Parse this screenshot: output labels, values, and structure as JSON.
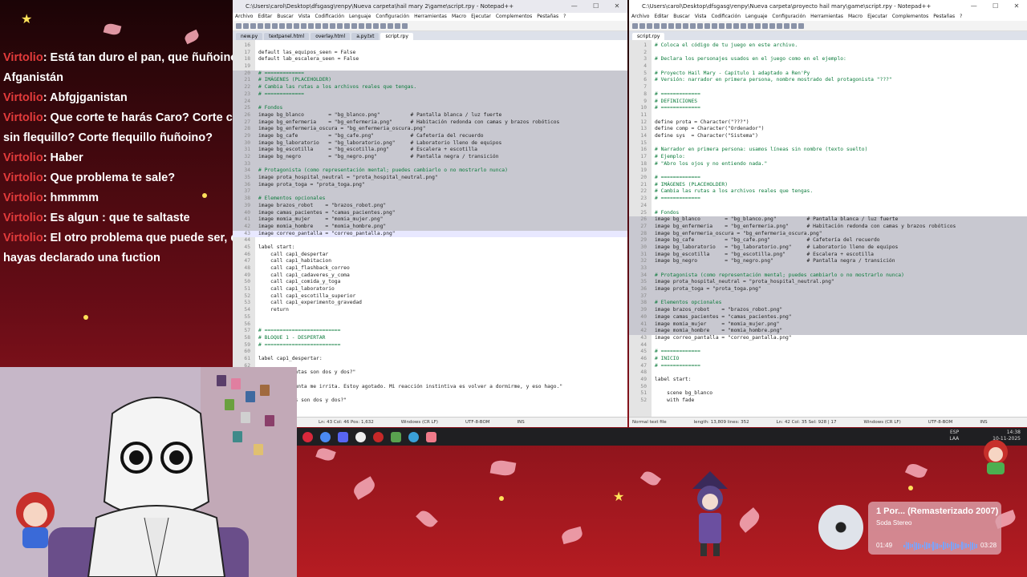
{
  "chat": {
    "lines": [
      {
        "user": "Virtolio",
        "msg": ": Está tan duro el pan, que ñuñoino en Afganistán"
      },
      {
        "user": "Virtolio",
        "msg": ": Abfgjganistan"
      },
      {
        "user": "Virtolio",
        "msg": ": Que corte te harás Caro? Corte callampa, sin flequillo? Corte flequillo ñuñoino?"
      },
      {
        "user": "Virtolio",
        "msg": ": Haber"
      },
      {
        "user": "Virtolio",
        "msg": ": Que problema te sale?"
      },
      {
        "user": "Virtolio",
        "msg": ": hmmmm"
      },
      {
        "user": "Virtolio",
        "msg": ": Es algun : que te saltaste"
      },
      {
        "user": "Virtolio",
        "msg": ": El otro problema que puede ser, es que no hayas declarado una fuction"
      }
    ]
  },
  "left_window": {
    "title": "C:\\Users\\carol\\Desktop\\dfsgasg\\renpy\\Nueva carpeta\\hail mary 2\\game\\script.rpy - Notepad++",
    "menu": [
      "Archivo",
      "Editar",
      "Buscar",
      "Vista",
      "Codificación",
      "Lenguaje",
      "Configuración",
      "Herramientas",
      "Macro",
      "Ejecutar",
      "Complementos",
      "Pestañas",
      "?"
    ],
    "tabs": [
      "new.py",
      "textpanel.html",
      "overlay.html",
      "a.py.txt",
      "script.rpy"
    ],
    "lines": [
      {
        "n": "16",
        "t": ""
      },
      {
        "n": "17",
        "t": "default las_equipos_seen = False"
      },
      {
        "n": "18",
        "t": "default lab_escalera_seen = False"
      },
      {
        "n": "19",
        "t": ""
      },
      {
        "n": "20",
        "t": "# ============="
      },
      {
        "n": "21",
        "t": "# IMÁGENES (PLACEHOLDER)"
      },
      {
        "n": "22",
        "t": "# Cambia las rutas a los archivos reales que tengas."
      },
      {
        "n": "23",
        "t": "# ============="
      },
      {
        "n": "24",
        "t": ""
      },
      {
        "n": "25",
        "t": "# Fondos"
      },
      {
        "n": "26",
        "t": "image bg_blanco        = \"bg_blanco.png\"          # Pantalla blanca / luz fuerte"
      },
      {
        "n": "27",
        "t": "image bg_enfermeria    = \"bg_enfermeria.png\"      # Habitación redonda con camas y brazos robóticos"
      },
      {
        "n": "28",
        "t": "image bg_enfermeria_oscura = \"bg_enfermeria_oscura.png\""
      },
      {
        "n": "29",
        "t": "image bg_cafe          = \"bg_cafe.png\"            # Cafetería del recuerdo"
      },
      {
        "n": "30",
        "t": "image bg_laboratorio   = \"bg_laboratorio.png\"     # Laboratorio lleno de equipos"
      },
      {
        "n": "31",
        "t": "image bg_escotilla     = \"bg_escotilla.png\"       # Escalera + escotilla"
      },
      {
        "n": "32",
        "t": "image bg_negro         = \"bg_negro.png\"           # Pantalla negra / transición"
      },
      {
        "n": "33",
        "t": ""
      },
      {
        "n": "34",
        "t": "# Protagonista (como representación mental; puedes cambiarlo o no mostrarlo nunca)"
      },
      {
        "n": "35",
        "t": "image prota_hospital_neutral = \"prota_hospital_neutral.png\""
      },
      {
        "n": "36",
        "t": "image prota_toga = \"prota_toga.png\""
      },
      {
        "n": "37",
        "t": ""
      },
      {
        "n": "38",
        "t": "# Elementos opcionales"
      },
      {
        "n": "39",
        "t": "image brazos_robot    = \"brazos_robot.png\""
      },
      {
        "n": "40",
        "t": "image camas_pacientes = \"camas_pacientes.png\""
      },
      {
        "n": "41",
        "t": "image momia_mujer     = \"momia_mujer.png\""
      },
      {
        "n": "42",
        "t": "image momia_hombre    = \"momia_hombre.png\""
      },
      {
        "n": "43",
        "t": "image correo_pantalla = \"correo_pantalla.png\""
      },
      {
        "n": "44",
        "t": ""
      },
      {
        "n": "45",
        "t": "label start:"
      },
      {
        "n": "46",
        "t": "    call cap1_despertar"
      },
      {
        "n": "47",
        "t": "    call cap1_habitacion"
      },
      {
        "n": "48",
        "t": "    call cap1_flashback_correo"
      },
      {
        "n": "49",
        "t": "    call cap1_cadaveres_y_coma"
      },
      {
        "n": "50",
        "t": "    call cap1_comida_y_toga"
      },
      {
        "n": "51",
        "t": "    call cap1_laboratorio"
      },
      {
        "n": "52",
        "t": "    call cap1_escotilla_superior"
      },
      {
        "n": "53",
        "t": "    call cap1_experimento_gravedad"
      },
      {
        "n": "54",
        "t": "    return"
      },
      {
        "n": "55",
        "t": ""
      },
      {
        "n": "56",
        "t": ""
      },
      {
        "n": "57",
        "t": "# ========================="
      },
      {
        "n": "58",
        "t": "# BLOQUE 1 - DESPERTAR"
      },
      {
        "n": "59",
        "t": "# ========================="
      },
      {
        "n": "60",
        "t": ""
      },
      {
        "n": "61",
        "t": "label cap1_despertar:"
      },
      {
        "n": "62",
        "t": ""
      },
      {
        "n": "63",
        "t": "    \"...¿Cuántas son dos y dos?\""
      },
      {
        "n": "64",
        "t": ""
      },
      {
        "n": "65",
        "t": "    \"La pregunta me irrita. Estoy agotado. Mi reacción instintiva es volver a dormirme, y eso hago.\""
      },
      {
        "n": "66",
        "t": ""
      },
      {
        "n": "67",
        "t": "    \"¿Cuántas son dos y dos?\""
      }
    ],
    "status": [
      "length: 19,354   lines: 552",
      "Ln: 43   Col: 46   Pos: 1,632",
      "Windows (CR LF)",
      "UTF-8-BOM",
      "INS"
    ]
  },
  "right_window": {
    "title": "C:\\Users\\carol\\Desktop\\dfsgasg\\renpy\\Nueva carpeta\\proyecto hail mary\\game\\script.rpy - Notepad++",
    "menu": [
      "Archivo",
      "Editar",
      "Buscar",
      "Vista",
      "Codificación",
      "Lenguaje",
      "Configuración",
      "Herramientas",
      "Macro",
      "Ejecutar",
      "Complementos",
      "Pestañas",
      "?"
    ],
    "tabs": [
      "script.rpy"
    ],
    "lines": [
      {
        "n": "1",
        "t": "# Coloca el código de tu juego en este archivo."
      },
      {
        "n": "2",
        "t": ""
      },
      {
        "n": "3",
        "t": "# Declara los personajes usados en el juego como en el ejemplo:"
      },
      {
        "n": "4",
        "t": ""
      },
      {
        "n": "5",
        "t": "# Proyecto Hail Mary - Capítulo 1 adaptado a Ren'Py"
      },
      {
        "n": "6",
        "t": "# Versión: narrador en primera persona, nombre mostrado del protagonista \"???\""
      },
      {
        "n": "7",
        "t": ""
      },
      {
        "n": "8",
        "t": "# ============="
      },
      {
        "n": "9",
        "t": "# DEFINICIONES"
      },
      {
        "n": "10",
        "t": "# ============="
      },
      {
        "n": "11",
        "t": ""
      },
      {
        "n": "12",
        "t": "define prota = Character(\"???\")"
      },
      {
        "n": "13",
        "t": "define comp = Character(\"Ordenador\")"
      },
      {
        "n": "14",
        "t": "define sys  = Character(\"Sistema\")"
      },
      {
        "n": "15",
        "t": ""
      },
      {
        "n": "16",
        "t": "# Narrador en primera persona: usamos líneas sin nombre (texto suelto)"
      },
      {
        "n": "17",
        "t": "# Ejemplo:"
      },
      {
        "n": "18",
        "t": "# \"Abro los ojos y no entiendo nada.\""
      },
      {
        "n": "19",
        "t": ""
      },
      {
        "n": "20",
        "t": "# ============="
      },
      {
        "n": "21",
        "t": "# IMÁGENES (PLACEHOLDER)"
      },
      {
        "n": "22",
        "t": "# Cambia las rutas a los archivos reales que tengas."
      },
      {
        "n": "23",
        "t": "# ============="
      },
      {
        "n": "24",
        "t": ""
      },
      {
        "n": "25",
        "t": "# Fondos"
      },
      {
        "n": "26",
        "t": "image bg_blanco        = \"bg_blanco.png\"          # Pantalla blanca / luz fuerte"
      },
      {
        "n": "27",
        "t": "image bg_enfermeria    = \"bg_enfermeria.png\"      # Habitación redonda con camas y brazos robóticos"
      },
      {
        "n": "28",
        "t": "image bg_enfermeria_oscura = \"bg_enfermeria_oscura.png\""
      },
      {
        "n": "29",
        "t": "image bg_cafe          = \"bg_cafe.png\"            # Cafetería del recuerdo"
      },
      {
        "n": "30",
        "t": "image bg_laboratorio   = \"bg_laboratorio.png\"     # Laboratorio lleno de equipos"
      },
      {
        "n": "31",
        "t": "image bg_escotilla     = \"bg_escotilla.png\"       # Escalera + escotilla"
      },
      {
        "n": "32",
        "t": "image bg_negro         = \"bg_negro.png\"           # Pantalla negra / transición"
      },
      {
        "n": "33",
        "t": ""
      },
      {
        "n": "34",
        "t": "# Protagonista (como representación mental; puedes cambiarlo o no mostrarlo nunca)"
      },
      {
        "n": "35",
        "t": "image prota_hospital_neutral = \"prota_hospital_neutral.png\""
      },
      {
        "n": "36",
        "t": "image prota_toga = \"prota_toga.png\""
      },
      {
        "n": "37",
        "t": ""
      },
      {
        "n": "38",
        "t": "# Elementos opcionales"
      },
      {
        "n": "39",
        "t": "image brazos_robot    = \"brazos_robot.png\""
      },
      {
        "n": "40",
        "t": "image camas_pacientes = \"camas_pacientes.png\""
      },
      {
        "n": "41",
        "t": "image momia_mujer     = \"momia_mujer.png\""
      },
      {
        "n": "42",
        "t": "image momia_hombre    = \"momia_hombre.png\""
      },
      {
        "n": "43",
        "t": "image correo_pantalla = \"correo_pantalla.png\""
      },
      {
        "n": "44",
        "t": ""
      },
      {
        "n": "45",
        "t": "# ============="
      },
      {
        "n": "46",
        "t": "# INICIO"
      },
      {
        "n": "47",
        "t": "# ============="
      },
      {
        "n": "48",
        "t": ""
      },
      {
        "n": "49",
        "t": "label start:"
      },
      {
        "n": "50",
        "t": ""
      },
      {
        "n": "51",
        "t": "    scene bg_blanco"
      },
      {
        "n": "52",
        "t": "    with fade"
      }
    ],
    "status": [
      "Normal text file",
      "length: 13,809   lines: 352",
      "Ln: 42   Col: 35   Sel: 928 | 17",
      "Windows (CR LF)",
      "UTF-8-BOM",
      "INS"
    ]
  },
  "tray": {
    "lang": "ESP\nLAA",
    "time": "14:38",
    "date": "10-11-2025"
  },
  "music": {
    "title": "1 Por... (Remasterizado 2007)",
    "artist": "Soda Stereo",
    "elapsed": "01:49",
    "total": "03:28"
  },
  "colors": {
    "chat_user": "#e33b3b",
    "accent": "#b61c22",
    "petal": "#f0a3b0"
  }
}
